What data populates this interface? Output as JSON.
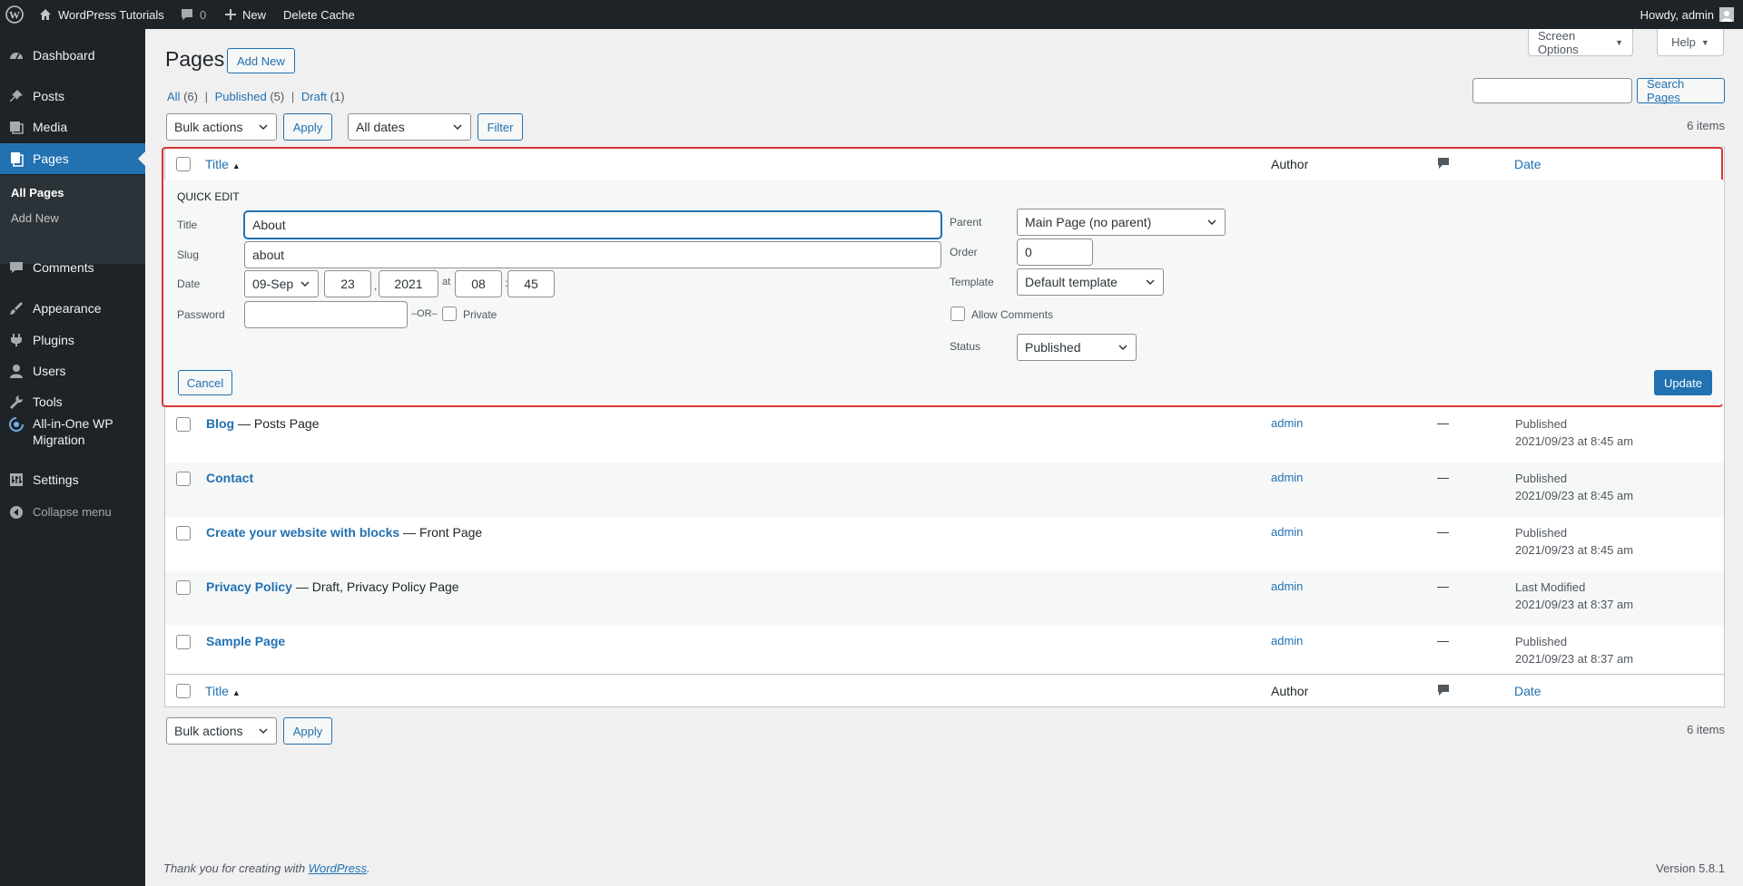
{
  "adminbar": {
    "site_name": "WordPress Tutorials",
    "comments_count": "0",
    "new_label": "New",
    "delete_cache": "Delete Cache",
    "howdy": "Howdy, admin"
  },
  "sidebar": {
    "items": [
      {
        "label": "Dashboard",
        "icon": "dashboard-icon"
      },
      {
        "label": "Posts",
        "icon": "pin-icon"
      },
      {
        "label": "Media",
        "icon": "media-icon"
      },
      {
        "label": "Pages",
        "icon": "pages-icon"
      },
      {
        "label": "Comments",
        "icon": "comment-icon"
      },
      {
        "label": "Appearance",
        "icon": "brush-icon"
      },
      {
        "label": "Plugins",
        "icon": "plugin-icon"
      },
      {
        "label": "Users",
        "icon": "user-icon"
      },
      {
        "label": "Tools",
        "icon": "wrench-icon"
      },
      {
        "label": "All-in-One WP Migration",
        "icon": "migration-icon"
      },
      {
        "label": "Settings",
        "icon": "settings-icon"
      }
    ],
    "submenu": [
      "All Pages",
      "Add New"
    ],
    "collapse": "Collapse menu"
  },
  "page": {
    "title": "Pages",
    "add_new": "Add New",
    "screen_options": "Screen Options",
    "help": "Help",
    "search_placeholder": "",
    "search_button": "Search Pages",
    "filters": {
      "all": "All",
      "all_count": "(6)",
      "published": "Published",
      "published_count": "(5)",
      "draft": "Draft",
      "draft_count": "(1)",
      "sep": "|"
    },
    "bulk_actions": "Bulk actions",
    "apply": "Apply",
    "all_dates": "All dates",
    "filter": "Filter",
    "items_count": "6 items"
  },
  "table": {
    "headers": {
      "title": "Title",
      "author": "Author",
      "date": "Date"
    },
    "rows": [
      {
        "title": "Blog",
        "state": " — Posts Page",
        "author": "admin",
        "comments": "—",
        "status": "Published",
        "date": "2021/09/23 at 8:45 am"
      },
      {
        "title": "Contact",
        "state": "",
        "author": "admin",
        "comments": "—",
        "status": "Published",
        "date": "2021/09/23 at 8:45 am"
      },
      {
        "title": "Create your website with blocks",
        "state": " — Front Page",
        "author": "admin",
        "comments": "—",
        "status": "Published",
        "date": "2021/09/23 at 8:45 am"
      },
      {
        "title": "Privacy Policy",
        "state": " — Draft, Privacy Policy Page",
        "author": "admin",
        "comments": "—",
        "status": "Last Modified",
        "date": "2021/09/23 at 8:37 am"
      },
      {
        "title": "Sample Page",
        "state": "",
        "author": "admin",
        "comments": "—",
        "status": "Published",
        "date": "2021/09/23 at 8:37 am"
      }
    ]
  },
  "quick_edit": {
    "heading": "QUICK EDIT",
    "title_label": "Title",
    "title_value": "About",
    "slug_label": "Slug",
    "slug_value": "about",
    "date_label": "Date",
    "month": "09-Sep",
    "day": "23",
    "year": "2021",
    "at": "at",
    "hour": "08",
    "minute": "45",
    "comma": ",",
    "colon": ":",
    "password_label": "Password",
    "password_value": "",
    "or": "–OR–",
    "private": "Private",
    "parent_label": "Parent",
    "parent_value": "Main Page (no parent)",
    "order_label": "Order",
    "order_value": "0",
    "template_label": "Template",
    "template_value": "Default template",
    "allow_comments": "Allow Comments",
    "status_label": "Status",
    "status_value": "Published",
    "cancel": "Cancel",
    "update": "Update"
  },
  "footer": {
    "thanks": "Thank you for creating with ",
    "wp_link": "WordPress",
    "period": ".",
    "version": "Version 5.8.1"
  },
  "colors": {
    "accent": "#2271b1",
    "adminbar": "#1d2327",
    "highlight": "#d63638"
  }
}
